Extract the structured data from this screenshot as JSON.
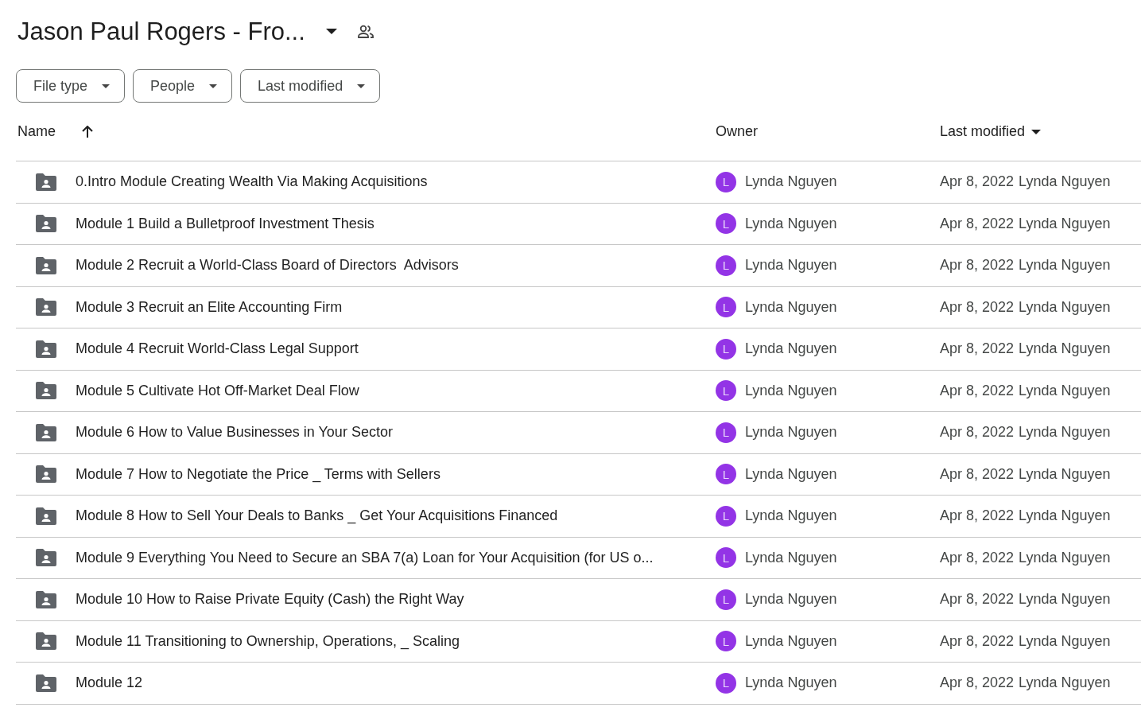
{
  "header": {
    "title": "Jason Paul Rogers - Fro..."
  },
  "filters": [
    {
      "label": "File type"
    },
    {
      "label": "People"
    },
    {
      "label": "Last modified"
    }
  ],
  "table": {
    "columns": [
      {
        "label": "Name",
        "sorted": true,
        "ascending": true
      },
      {
        "label": "Owner",
        "sorted": false
      },
      {
        "label": "Last modified",
        "sorted": true,
        "ascending": false
      }
    ],
    "rows": [
      {
        "name": "0.Intro Module Creating Wealth Via Making Acquisitions",
        "owner_initial": "L",
        "owner": "Lynda Nguyen",
        "modified_date": "Apr 8, 2022",
        "modified_by": "Lynda Nguyen"
      },
      {
        "name": "Module 1 Build a Bulletproof Investment Thesis",
        "owner_initial": "L",
        "owner": "Lynda Nguyen",
        "modified_date": "Apr 8, 2022",
        "modified_by": "Lynda Nguyen"
      },
      {
        "name": "Module 2 Recruit a World-Class Board of Directors  Advisors",
        "owner_initial": "L",
        "owner": "Lynda Nguyen",
        "modified_date": "Apr 8, 2022",
        "modified_by": "Lynda Nguyen"
      },
      {
        "name": "Module 3 Recruit an Elite Accounting Firm",
        "owner_initial": "L",
        "owner": "Lynda Nguyen",
        "modified_date": "Apr 8, 2022",
        "modified_by": "Lynda Nguyen"
      },
      {
        "name": "Module 4 Recruit World-Class Legal Support",
        "owner_initial": "L",
        "owner": "Lynda Nguyen",
        "modified_date": "Apr 8, 2022",
        "modified_by": "Lynda Nguyen"
      },
      {
        "name": "Module 5 Cultivate Hot Off-Market Deal Flow",
        "owner_initial": "L",
        "owner": "Lynda Nguyen",
        "modified_date": "Apr 8, 2022",
        "modified_by": "Lynda Nguyen"
      },
      {
        "name": "Module 6 How to Value Businesses in Your Sector",
        "owner_initial": "L",
        "owner": "Lynda Nguyen",
        "modified_date": "Apr 8, 2022",
        "modified_by": "Lynda Nguyen"
      },
      {
        "name": "Module 7 How to Negotiate the Price _ Terms with Sellers",
        "owner_initial": "L",
        "owner": "Lynda Nguyen",
        "modified_date": "Apr 8, 2022",
        "modified_by": "Lynda Nguyen"
      },
      {
        "name": "Module 8 How to Sell Your Deals to Banks _ Get Your Acquisitions Financed",
        "owner_initial": "L",
        "owner": "Lynda Nguyen",
        "modified_date": "Apr 8, 2022",
        "modified_by": "Lynda Nguyen"
      },
      {
        "name": "Module 9 Everything You Need to Secure an SBA 7(a) Loan for Your Acquisition (for US o...",
        "owner_initial": "L",
        "owner": "Lynda Nguyen",
        "modified_date": "Apr 8, 2022",
        "modified_by": "Lynda Nguyen"
      },
      {
        "name": "Module 10 How to Raise Private Equity (Cash) the Right Way",
        "owner_initial": "L",
        "owner": "Lynda Nguyen",
        "modified_date": "Apr 8, 2022",
        "modified_by": "Lynda Nguyen"
      },
      {
        "name": "Module 11 Transitioning to Ownership, Operations, _ Scaling",
        "owner_initial": "L",
        "owner": "Lynda Nguyen",
        "modified_date": "Apr 8, 2022",
        "modified_by": "Lynda Nguyen"
      },
      {
        "name": "Module 12",
        "owner_initial": "L",
        "owner": "Lynda Nguyen",
        "modified_date": "Apr 8, 2022",
        "modified_by": "Lynda Nguyen"
      }
    ]
  }
}
